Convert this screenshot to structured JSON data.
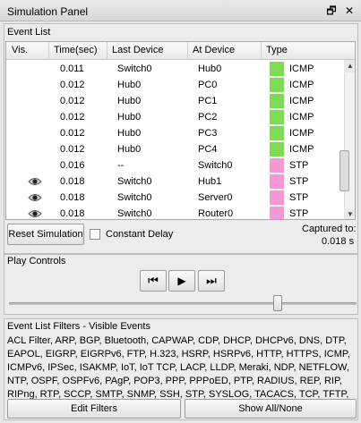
{
  "window": {
    "title": "Simulation Panel",
    "restore_glyph": "🗗",
    "close_glyph": "✕"
  },
  "event_list": {
    "title": "Event List",
    "columns": [
      "Vis.",
      "Time(sec)",
      "Last Device",
      "At Device",
      "Type"
    ],
    "rows": [
      {
        "visible": false,
        "time": "0.011",
        "last": "Switch0",
        "at": "Hub0",
        "type": "ICMP",
        "color": "#7ddc52"
      },
      {
        "visible": false,
        "time": "0.012",
        "last": "Hub0",
        "at": "PC0",
        "type": "ICMP",
        "color": "#7ddc52"
      },
      {
        "visible": false,
        "time": "0.012",
        "last": "Hub0",
        "at": "PC1",
        "type": "ICMP",
        "color": "#7ddc52"
      },
      {
        "visible": false,
        "time": "0.012",
        "last": "Hub0",
        "at": "PC2",
        "type": "ICMP",
        "color": "#7ddc52"
      },
      {
        "visible": false,
        "time": "0.012",
        "last": "Hub0",
        "at": "PC3",
        "type": "ICMP",
        "color": "#7ddc52"
      },
      {
        "visible": false,
        "time": "0.012",
        "last": "Hub0",
        "at": "PC4",
        "type": "ICMP",
        "color": "#7ddc52"
      },
      {
        "visible": false,
        "time": "0.016",
        "last": "--",
        "at": "Switch0",
        "type": "STP",
        "color": "#f598d8"
      },
      {
        "visible": true,
        "time": "0.018",
        "last": "Switch0",
        "at": "Hub1",
        "type": "STP",
        "color": "#f598d8"
      },
      {
        "visible": true,
        "time": "0.018",
        "last": "Switch0",
        "at": "Server0",
        "type": "STP",
        "color": "#f598d8"
      },
      {
        "visible": true,
        "time": "0.018",
        "last": "Switch0",
        "at": "Router0",
        "type": "STP",
        "color": "#f598d8"
      }
    ],
    "reset_label": "Reset Simulation",
    "constant_delay_label": "Constant Delay",
    "constant_delay_checked": false,
    "captured_label": "Captured to:",
    "captured_value": "0.018 s"
  },
  "play_controls": {
    "title": "Play Controls",
    "back_glyph": "⏮",
    "play_glyph": "▶",
    "forward_glyph": "⏭",
    "slider_position": 0.76
  },
  "filters": {
    "title": "Event List Filters - Visible Events",
    "text": "ACL Filter, ARP, BGP, Bluetooth, CAPWAP, CDP, DHCP, DHCPv6, DNS, DTP, EAPOL, EIGRP, EIGRPv6, FTP, H.323, HSRP, HSRPv6, HTTP, HTTPS, ICMP, ICMPv6, IPSec, ISAKMP, IoT, IoT TCP, LACP, LLDP, Meraki, NDP, NETFLOW, NTP, OSPF, OSPFv6, PAgP, POP3, PPP, PPPoED, PTP, RADIUS, REP, RIP, RIPng, RTP, SCCP, SMTP, SNMP, SSH, STP, SYSLOG, TACACS, TCP, TFTP, Telnet, UDP, USB, VTP",
    "edit_label": "Edit Filters",
    "show_all_label": "Show All/None"
  },
  "colors": {
    "icmp": "#7ddc52",
    "stp": "#f598d8"
  },
  "icons": {
    "visible": "eye-icon",
    "back": "step-back-icon",
    "play": "play-icon",
    "forward": "step-forward-icon"
  }
}
